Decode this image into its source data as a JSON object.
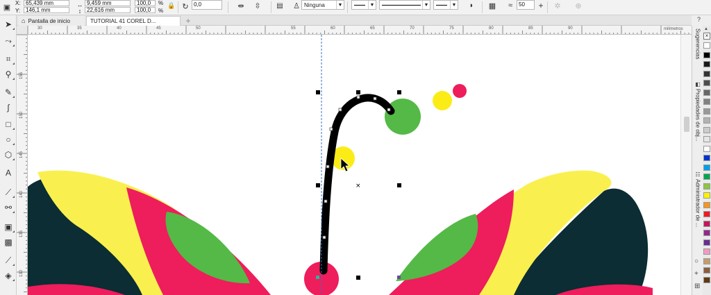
{
  "property_bar": {
    "x_label": "X:",
    "x_value": "65,439 mm",
    "y_label": "Y:",
    "y_value": "146,1 mm",
    "width_value": "9,459 mm",
    "height_value": "22,616 mm",
    "scale_x": "100,0",
    "scale_y": "100,0",
    "percent_sign_1": "%",
    "percent_sign_2": "%",
    "rotation_value": "0,0",
    "outline_style": "Ninguna",
    "smoothing_value": "50"
  },
  "tabs": {
    "home_label": "Pantalla de inicio",
    "doc_label": "TUTORIAL 41 COREL D..."
  },
  "ruler": {
    "unit": "milímetros",
    "top_labels": [
      "30",
      "35",
      "40",
      "45",
      "50",
      "55",
      "60",
      "65",
      "70",
      "75",
      "80",
      "85",
      "90"
    ],
    "left_labels": [
      "155",
      "150",
      "145",
      "140",
      "135",
      "130",
      "125"
    ]
  },
  "docker": {
    "tab1_label": "Sugerencias",
    "tab2_label": "Propiedades de obj...",
    "tab3_label": "Administrador de ..."
  },
  "colors": {
    "pink": "#ee1d5c",
    "yellow": "#fbec18",
    "green": "#54b946",
    "dark_teal": "#0b2d33",
    "bright_yellow": "#f9f04f",
    "stroke_black": "#000000"
  },
  "palette_colors": [
    "#ffffff",
    "#000000",
    "#1a1a1a",
    "#333333",
    "#4d4d4d",
    "#666666",
    "#808080",
    "#999999",
    "#b3b3b3",
    "#cccccc",
    "#e6e6e6",
    "#ffffff",
    "#0033cc",
    "#00a0e9",
    "#00a651",
    "#8dc63f",
    "#fff200",
    "#f7941d",
    "#ed1c24",
    "#c2185b",
    "#92278f",
    "#662d91",
    "#f49ac1",
    "#c69c6d",
    "#8b5e3c",
    "#603913"
  ]
}
